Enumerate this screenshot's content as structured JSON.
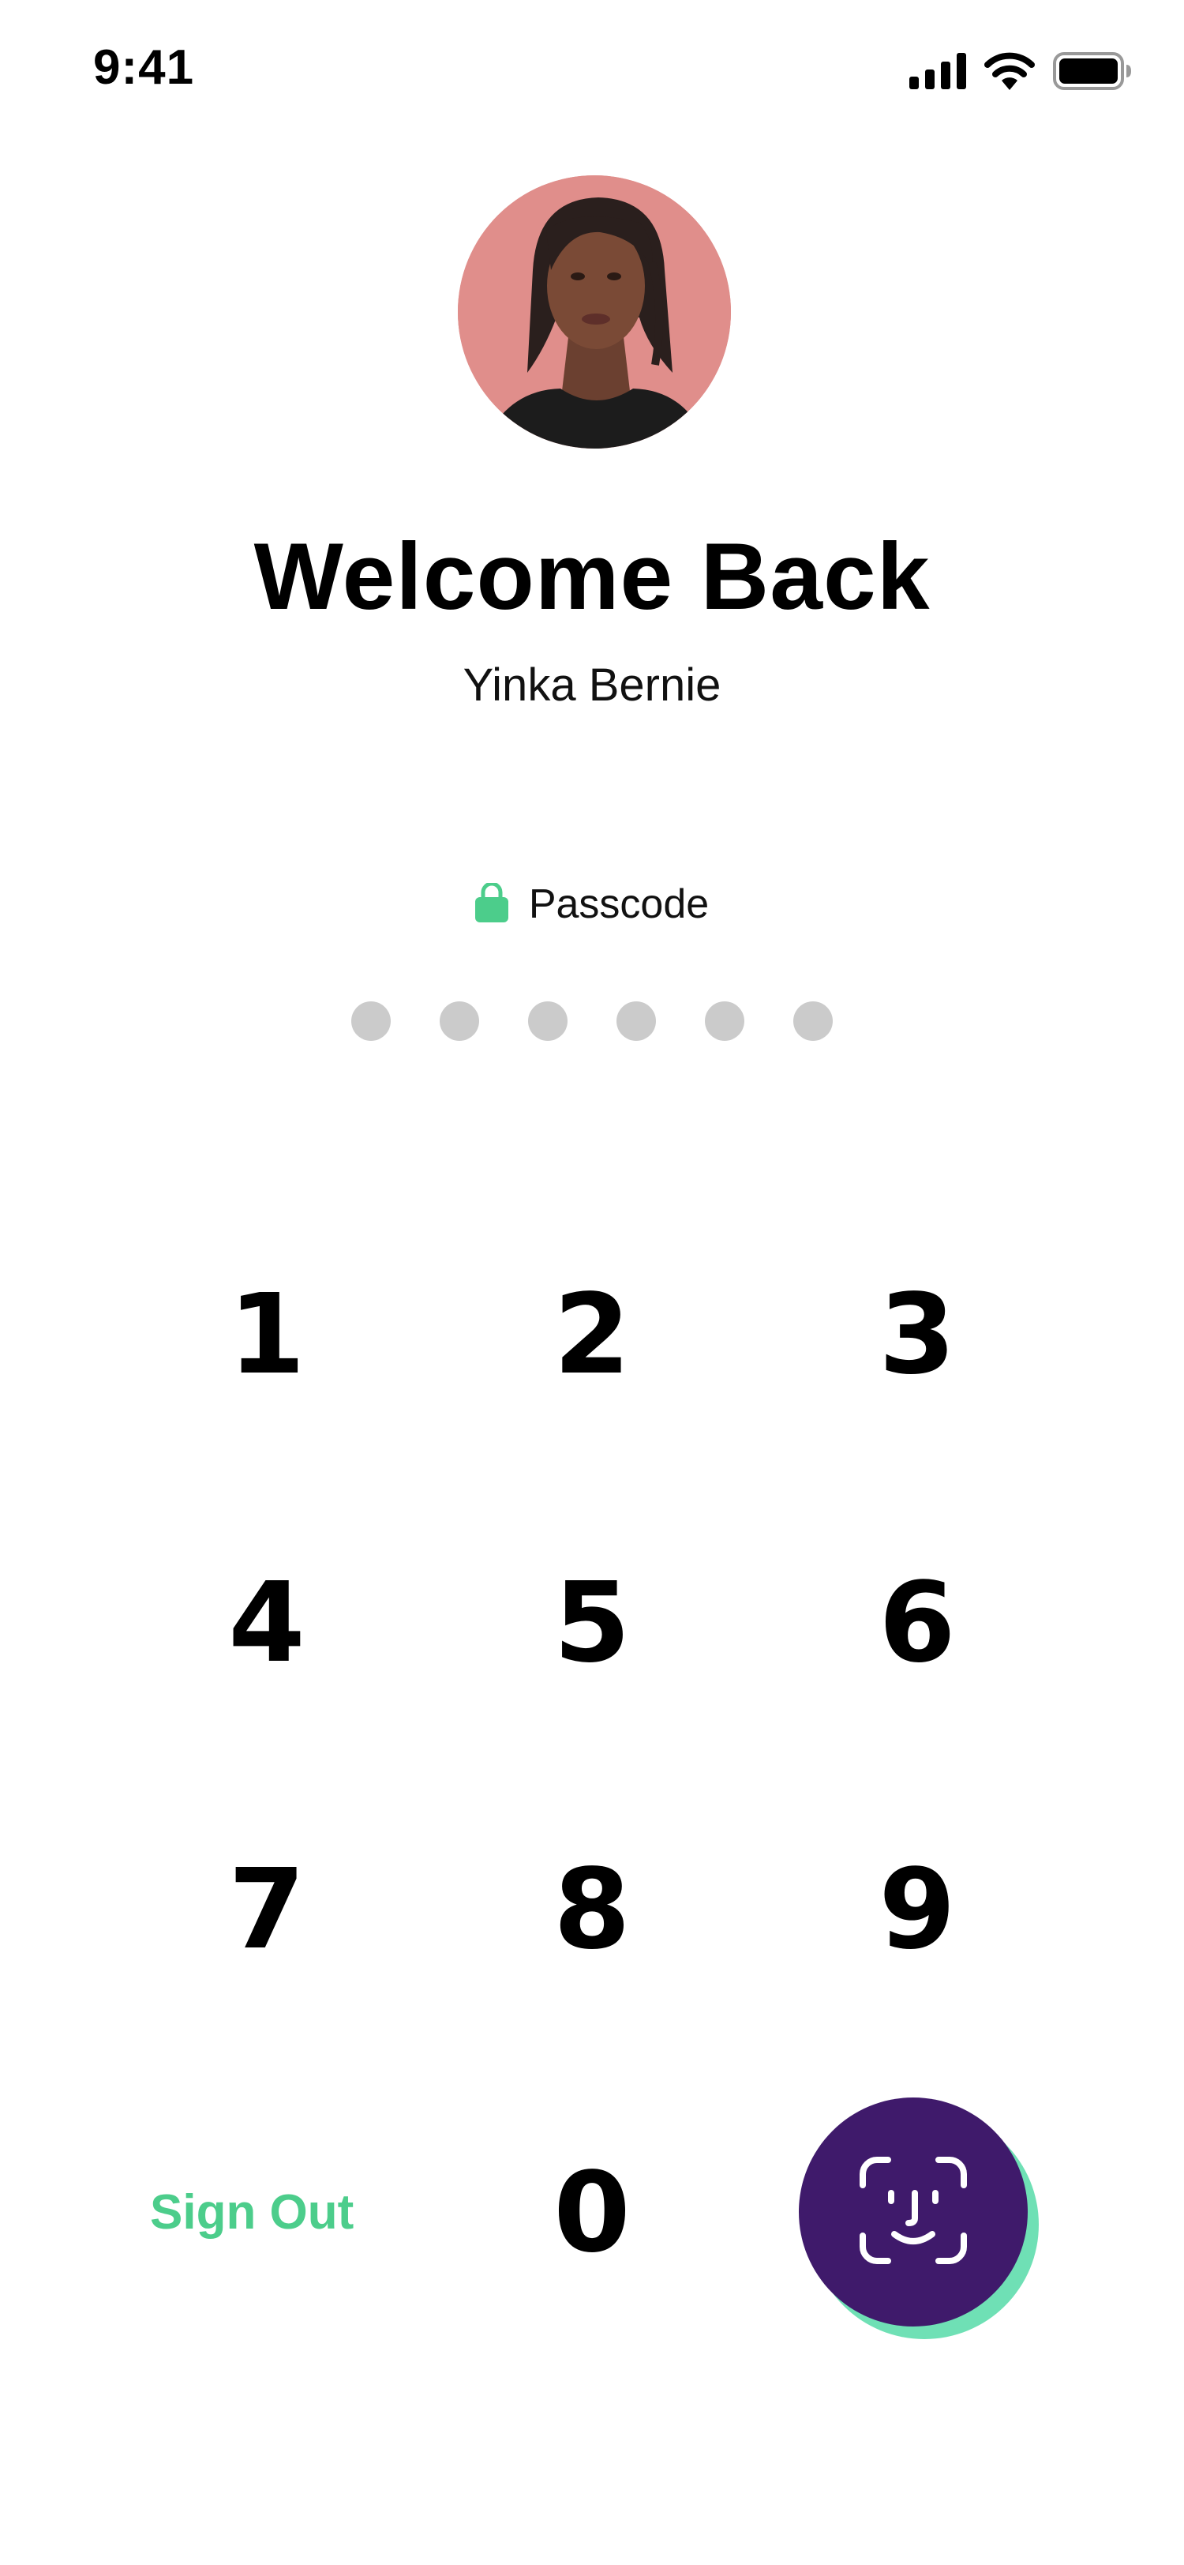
{
  "status_bar": {
    "time": "9:41",
    "icons": [
      "signal-icon",
      "wifi-icon",
      "battery-icon"
    ]
  },
  "profile": {
    "title": "Welcome Back",
    "name": "Yinka Bernie"
  },
  "passcode": {
    "label": "Passcode",
    "icon": "lock-icon",
    "digits_total": 6,
    "digits_entered": 0
  },
  "keypad": {
    "k1": "1",
    "k2": "2",
    "k3": "3",
    "k4": "4",
    "k5": "5",
    "k6": "6",
    "k7": "7",
    "k8": "8",
    "k9": "9",
    "k0": "0",
    "sign_out": "Sign Out",
    "biometric_icon": "face-id-icon"
  },
  "colors": {
    "accent_green": "#4ccd8b",
    "faceid_purple": "#3f1a6b",
    "faceid_shadow": "#6fe0b5",
    "dot_empty": "#cbcbcb"
  }
}
